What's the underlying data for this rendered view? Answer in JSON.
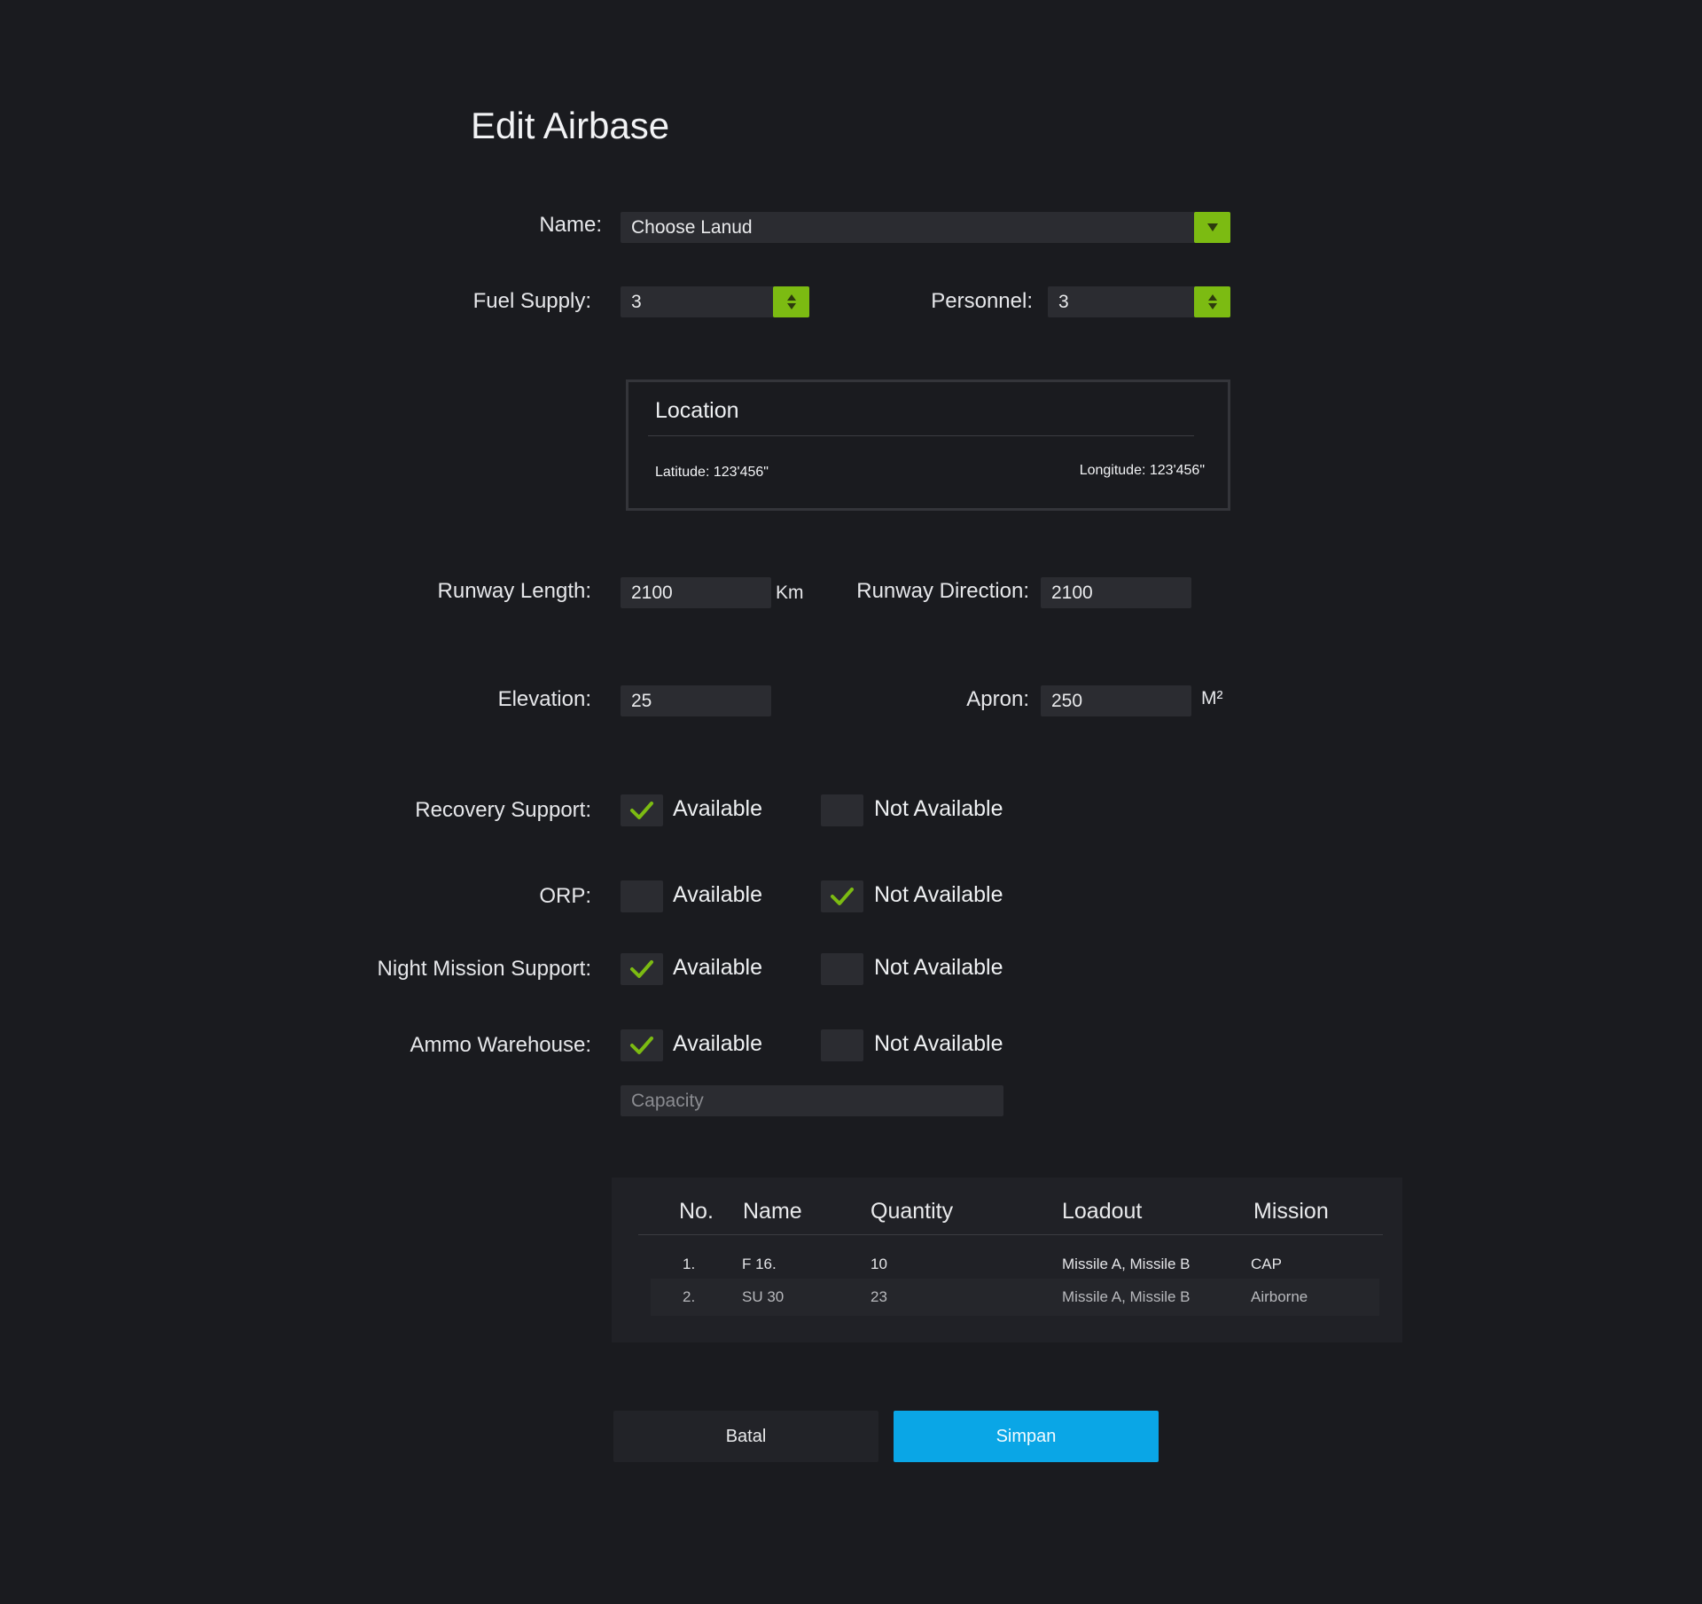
{
  "page": {
    "title": "Edit Airbase"
  },
  "form": {
    "name": {
      "label": "Name:",
      "value": "Choose Lanud"
    },
    "fuel_supply": {
      "label": "Fuel Supply:",
      "value": "3"
    },
    "personnel": {
      "label": "Personnel:",
      "value": "3"
    },
    "location": {
      "title": "Location",
      "latitude": "Latitude: 123'456\"",
      "longitude": "Longitude: 123'456\""
    },
    "runway_length": {
      "label": "Runway Length:",
      "value": "2100",
      "unit": "Km"
    },
    "runway_direction": {
      "label": "Runway Direction:",
      "value": "2100"
    },
    "elevation": {
      "label": "Elevation:",
      "value": "25"
    },
    "apron": {
      "label": "Apron:",
      "value": "250",
      "unit": "M²"
    },
    "options": {
      "available": "Available",
      "not_available": "Not Available"
    },
    "recovery_support": {
      "label": "Recovery Support:",
      "selected": "available"
    },
    "orp": {
      "label": "ORP:",
      "selected": "not_available"
    },
    "night_mission_support": {
      "label": "Night Mission Support:",
      "selected": "available"
    },
    "ammo_warehouse": {
      "label": "Ammo Warehouse:",
      "selected": "available",
      "capacity_placeholder": "Capacity"
    }
  },
  "table": {
    "headers": [
      "No.",
      "Name",
      "Quantity",
      "Loadout",
      "Mission"
    ],
    "rows": [
      [
        "1.",
        "F 16.",
        "10",
        "Missile A, Missile B",
        "CAP"
      ],
      [
        "2.",
        "SU 30",
        "23",
        "Missile A, Missile B",
        "Airborne"
      ]
    ]
  },
  "actions": {
    "cancel": "Batal",
    "save": "Simpan"
  },
  "colors": {
    "accent": "#7cbb12",
    "primary": "#0aa6e6",
    "background": "#1a1b1f",
    "field": "#2b2c31"
  }
}
